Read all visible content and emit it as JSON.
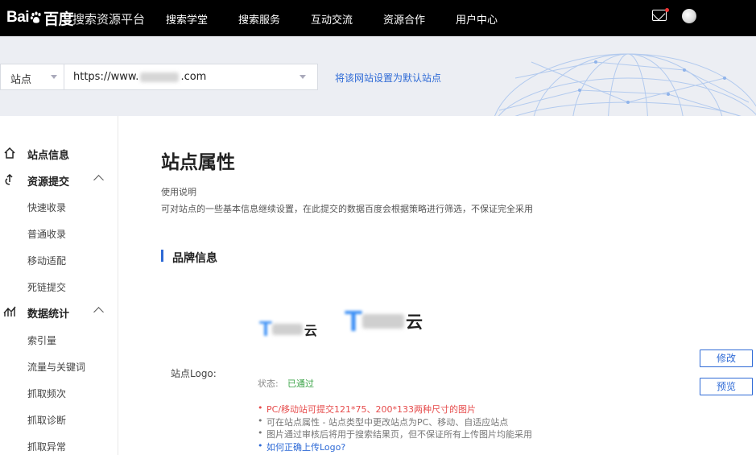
{
  "topnav": {
    "logo_text_left": "Bai",
    "logo_text_right": "百度",
    "platform_name": "搜索资源平台",
    "items": [
      "搜索学堂",
      "搜索服务",
      "互动交流",
      "资源合作",
      "用户中心"
    ]
  },
  "sitebar": {
    "site_type": "站点",
    "site_url_prefix": "https://www.",
    "site_url_suffix": ".com",
    "default_link": "将该网站设置为默认站点"
  },
  "sidebar": {
    "groups": [
      {
        "label": "站点信息",
        "icon": "home-icon",
        "expandable": false,
        "items": []
      },
      {
        "label": "资源提交",
        "icon": "submit-icon",
        "expandable": true,
        "items": [
          "快速收录",
          "普通收录",
          "移动适配",
          "死链提交"
        ]
      },
      {
        "label": "数据统计",
        "icon": "stats-icon",
        "expandable": true,
        "items": [
          "索引量",
          "流量与关键词",
          "抓取频次",
          "抓取诊断",
          "抓取异常"
        ]
      }
    ]
  },
  "main": {
    "title": "站点属性",
    "usage_label": "使用说明",
    "usage_desc": "可对站点的一些基本信息继续设置，在此提交的数据百度会根据策略进行筛选，不保证完全采用",
    "section_title": "品牌信息",
    "logo_label": "站点Logo:",
    "logo_brand_char": "云",
    "status_label": "状态:",
    "status_value": "已通过",
    "notes": [
      "PC/移动站可提交121*75、200*133两种尺寸的图片",
      "可在站点属性 - 站点类型中更改站点为PC、移动、自适应站点",
      "图片通过审核后将用于搜索结果页，但不保证所有上传图片均能采用",
      "如何正确上传Logo?"
    ],
    "edit_button": "修改",
    "preview_button": "预览"
  },
  "colors": {
    "accent": "#2e6ad6",
    "topbar": "#000000",
    "status_ok": "#3aa346",
    "note_red": "#e64b4b"
  }
}
